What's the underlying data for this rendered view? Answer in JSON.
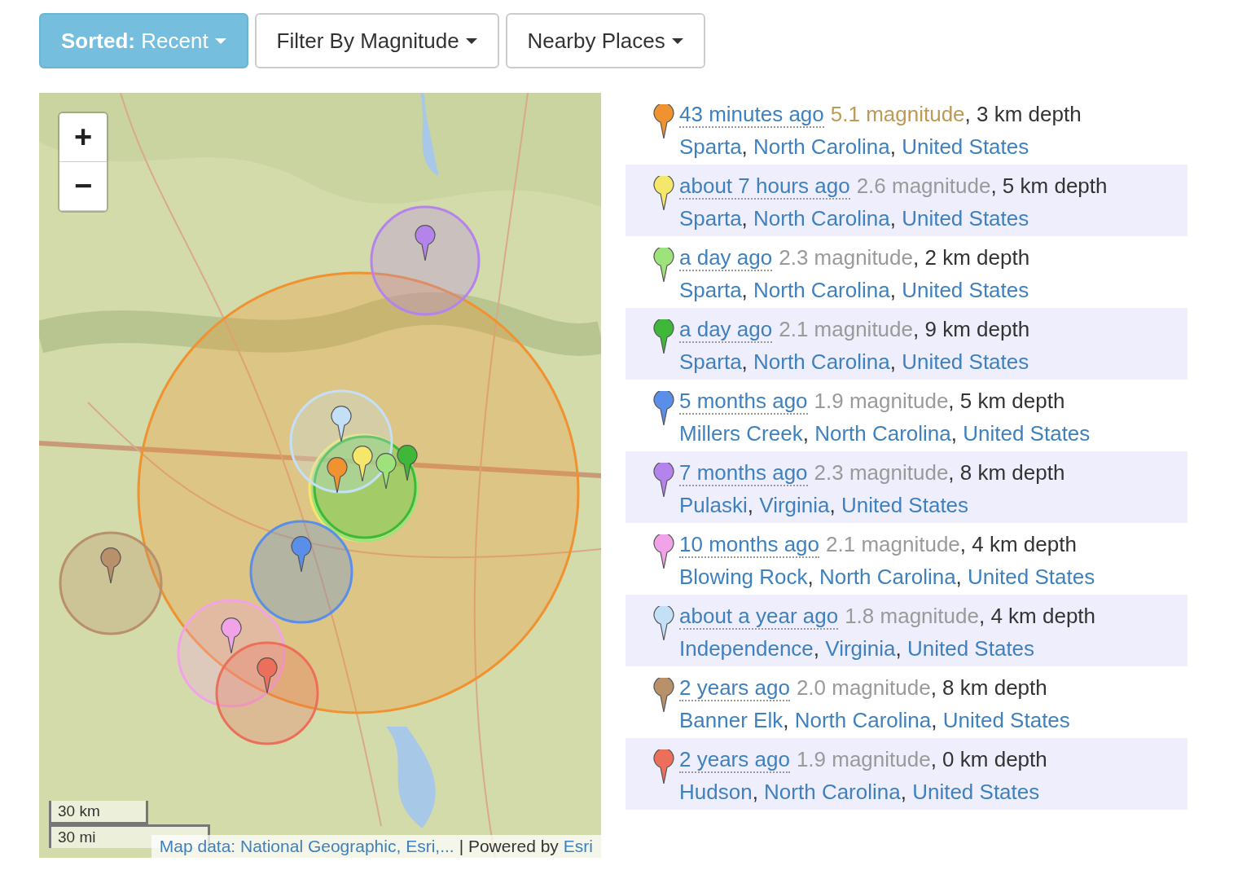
{
  "toolbar": [
    {
      "label": "**Sorted:** Recent",
      "selected": true
    },
    {
      "label": "Filter By Magnitude",
      "selected": false
    },
    {
      "label": "Nearby Places",
      "selected": false
    }
  ],
  "map": {
    "zoom_in": "+",
    "zoom_out": "−",
    "scale_km": "30 km",
    "scale_mi": "30 mi",
    "attribution": "Map data: National Geographic, Esri,...",
    "powered": "| Powered by",
    "powered_link": "Esri"
  },
  "events": [
    {
      "time": "43 minutes ago",
      "magnitude": "5.1 magnitude",
      "notable": true,
      "depth": ", 3 km depth",
      "color": "#f0922f",
      "places": [
        {
          "name": "Sparta",
          "after": ", "
        },
        {
          "name": "North Carolina",
          "after": ", "
        },
        {
          "name": "United States"
        }
      ]
    },
    {
      "time": "about 7 hours ago",
      "magnitude": "2.6 magnitude",
      "notable": false,
      "depth": ", 5 km depth",
      "color": "#f5e76a",
      "places": [
        {
          "name": "Sparta",
          "after": ", "
        },
        {
          "name": "North Carolina",
          "after": ", "
        },
        {
          "name": "United States"
        }
      ]
    },
    {
      "time": "a day ago",
      "magnitude": "2.3 magnitude",
      "notable": false,
      "depth": ", 2 km depth",
      "color": "#9ee27c",
      "places": [
        {
          "name": "Sparta",
          "after": ", "
        },
        {
          "name": "North Carolina",
          "after": ", "
        },
        {
          "name": "United States"
        }
      ]
    },
    {
      "time": "a day ago",
      "magnitude": "2.1 magnitude",
      "notable": false,
      "depth": ", 9 km depth",
      "color": "#3fb83a",
      "places": [
        {
          "name": "Sparta",
          "after": ", "
        },
        {
          "name": "North Carolina",
          "after": ", "
        },
        {
          "name": "United States"
        }
      ]
    },
    {
      "time": "5 months ago",
      "magnitude": "1.9 magnitude",
      "notable": false,
      "depth": ", 5 km depth",
      "color": "#5b8ee8",
      "places": [
        {
          "name": "Millers Creek",
          "after": ", "
        },
        {
          "name": "North Carolina",
          "after": ", "
        },
        {
          "name": "United States"
        }
      ]
    },
    {
      "time": "7 months ago",
      "magnitude": "2.3 magnitude",
      "notable": false,
      "depth": ", 8 km depth",
      "color": "#b483ec",
      "places": [
        {
          "name": "Pulaski",
          "after": ", "
        },
        {
          "name": "Virginia",
          "after": ", "
        },
        {
          "name": "United States"
        }
      ]
    },
    {
      "time": "10 months ago",
      "magnitude": "2.1 magnitude",
      "notable": false,
      "depth": ", 4 km depth",
      "color": "#f2a3e8",
      "places": [
        {
          "name": "Blowing Rock",
          "after": ", "
        },
        {
          "name": "North Carolina",
          "after": ", "
        },
        {
          "name": "United States"
        }
      ]
    },
    {
      "time": "about a year ago",
      "magnitude": "1.8 magnitude",
      "notable": false,
      "depth": ", 4 km depth",
      "color": "#c4e0f6",
      "places": [
        {
          "name": "Independence",
          "after": ", "
        },
        {
          "name": "Virginia",
          "after": ", "
        },
        {
          "name": "United States"
        }
      ]
    },
    {
      "time": "2 years ago",
      "magnitude": "2.0 magnitude",
      "notable": false,
      "depth": ", 8 km depth",
      "color": "#b8906a",
      "places": [
        {
          "name": "Banner Elk",
          "after": ", "
        },
        {
          "name": "North Carolina",
          "after": ", "
        },
        {
          "name": "United States"
        }
      ]
    },
    {
      "time": "2 years ago",
      "magnitude": "1.9 magnitude",
      "notable": false,
      "depth": ", 0 km depth",
      "color": "#ec6f5c",
      "places": [
        {
          "name": "Hudson",
          "after": ", "
        },
        {
          "name": "North Carolina",
          "after": ", "
        },
        {
          "name": "United States"
        }
      ]
    }
  ]
}
